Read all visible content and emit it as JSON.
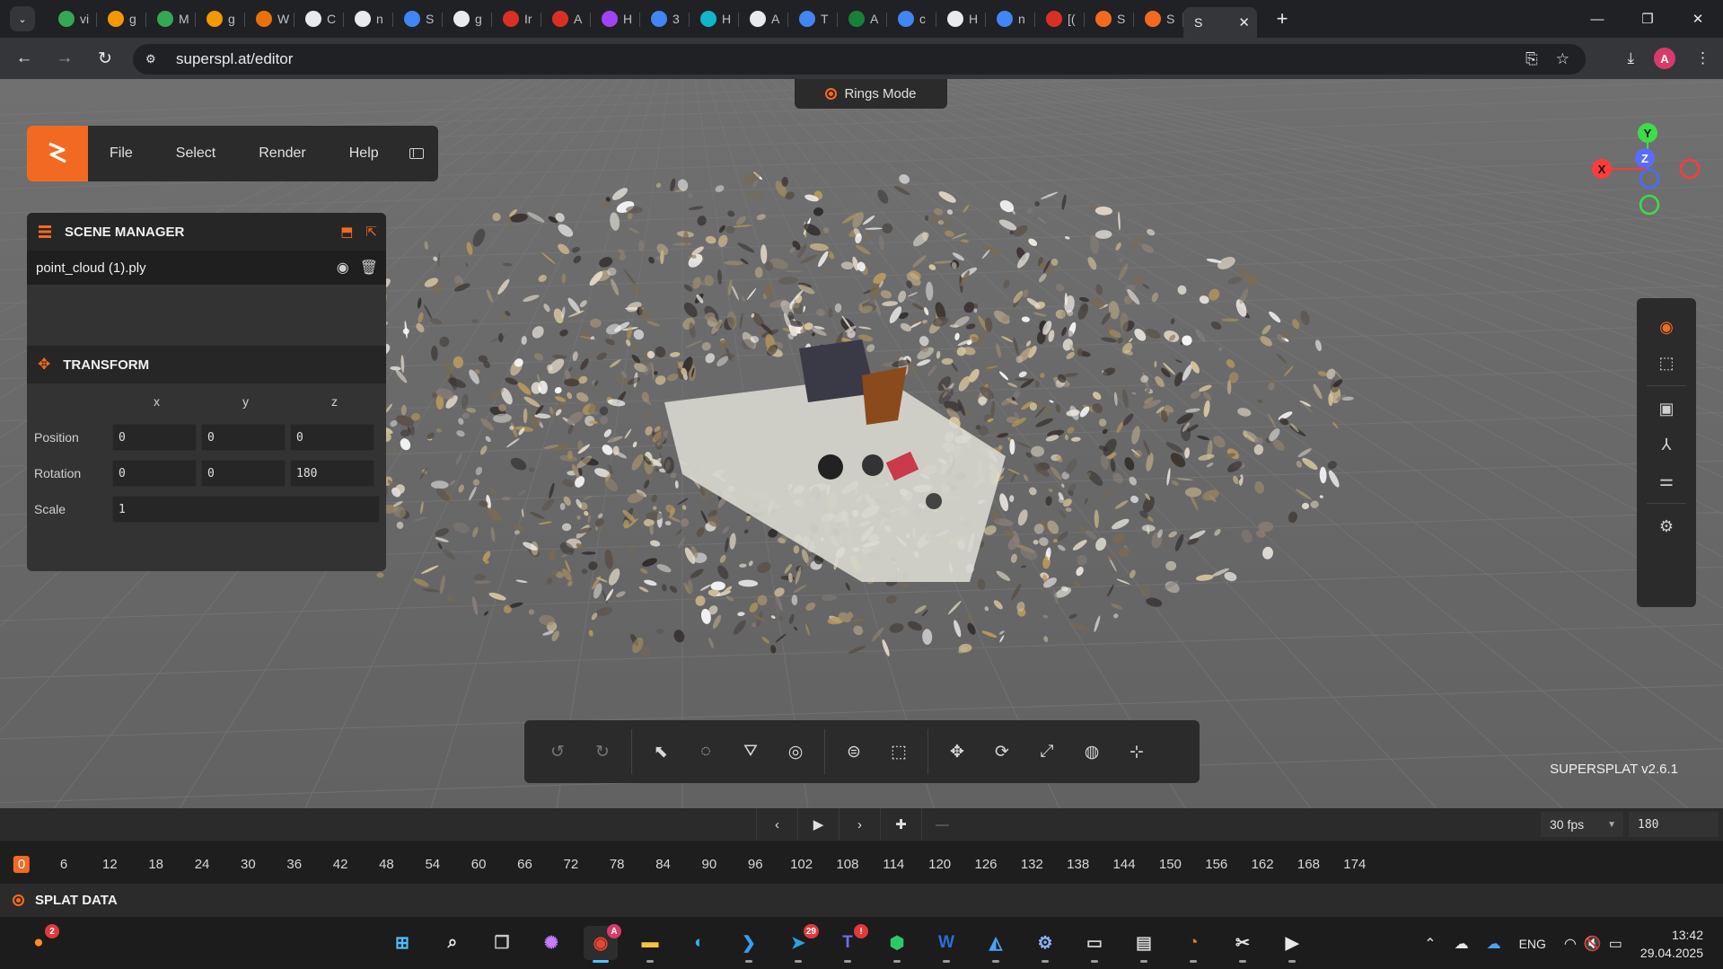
{
  "browser": {
    "tabs": [
      {
        "letter": "vi",
        "color": "#34a853"
      },
      {
        "letter": "g",
        "color": "#f29900"
      },
      {
        "letter": "M",
        "color": "#34a853"
      },
      {
        "letter": "g",
        "color": "#f29900"
      },
      {
        "letter": "W",
        "color": "#e8710a"
      },
      {
        "letter": "C",
        "color": "#e8eaed"
      },
      {
        "letter": "n",
        "color": "#e8eaed"
      },
      {
        "letter": "S",
        "color": "#4285f4"
      },
      {
        "letter": "g",
        "color": "#e8eaed"
      },
      {
        "letter": "Ir",
        "color": "#d93025"
      },
      {
        "letter": "A",
        "color": "#d93025"
      },
      {
        "letter": "H",
        "color": "#a142f4"
      },
      {
        "letter": "3",
        "color": "#4285f4"
      },
      {
        "letter": "H",
        "color": "#12b5cb"
      },
      {
        "letter": "A",
        "color": "#e8eaed"
      },
      {
        "letter": "T",
        "color": "#4285f4"
      },
      {
        "letter": "A",
        "color": "#188038"
      },
      {
        "letter": "c",
        "color": "#4285f4"
      },
      {
        "letter": "H",
        "color": "#e8eaed"
      },
      {
        "letter": "n",
        "color": "#4285f4"
      },
      {
        "letter": "[(",
        "color": "#d93025"
      },
      {
        "letter": "S",
        "color": "#f26a22"
      },
      {
        "letter": "S",
        "color": "#f26a22"
      }
    ],
    "active_tab": {
      "letter": "S",
      "close": "✕"
    },
    "new_tab": "+",
    "url": "superspl.at/editor"
  },
  "app": {
    "menu": [
      "File",
      "Select",
      "Render",
      "Help"
    ],
    "rings_mode": "Rings Mode",
    "scene_manager": {
      "title": "SCENE MANAGER",
      "file": "point_cloud (1).ply"
    },
    "transform": {
      "title": "TRANSFORM",
      "axes": [
        "x",
        "y",
        "z"
      ],
      "position_label": "Position",
      "rotation_label": "Rotation",
      "scale_label": "Scale",
      "position": [
        "0",
        "0",
        "0"
      ],
      "rotation": [
        "0",
        "0",
        "180"
      ],
      "scale": "1"
    },
    "gizmo": {
      "x": "X",
      "y": "Y",
      "z": "Z"
    },
    "version": "SUPERSPLAT v2.6.1",
    "accent": "#f26a22",
    "timeline": {
      "fps": "30 fps",
      "frames": "180",
      "current_frame": "0",
      "ticks": [
        "6",
        "12",
        "18",
        "24",
        "30",
        "36",
        "42",
        "48",
        "54",
        "60",
        "66",
        "72",
        "78",
        "84",
        "90",
        "96",
        "102",
        "108",
        "114",
        "120",
        "126",
        "132",
        "138",
        "144",
        "150",
        "156",
        "162",
        "168",
        "174"
      ]
    },
    "splat_data_title": "SPLAT DATA"
  },
  "taskbar": {
    "firefox_badge": "2",
    "chrome_badge": "A",
    "telegram_badge": "29",
    "teams_badge": "!",
    "word_letter": "W",
    "language": "ENG",
    "time": "13:42",
    "date": "29.04.2025"
  }
}
